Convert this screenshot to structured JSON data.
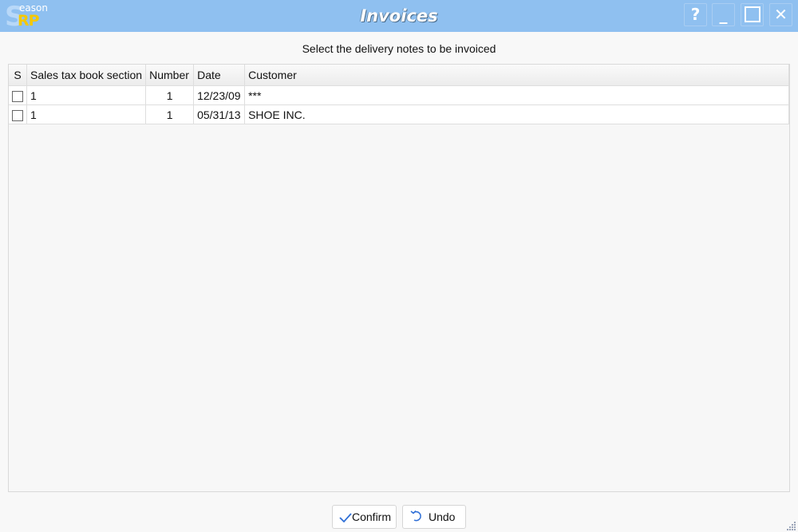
{
  "app": {
    "logo_main": "S",
    "logo_sub": "eason",
    "logo_accent": "RP",
    "window_title": "Invoices"
  },
  "window_controls": {
    "help": "?",
    "minimize": "_",
    "maximize": "☐",
    "close": "✕"
  },
  "prompt": "Select the delivery notes to be invoiced",
  "table": {
    "columns": [
      "S",
      "Sales tax book section",
      "Number",
      "Date",
      "Customer"
    ],
    "rows": [
      {
        "selected": false,
        "section": "1",
        "number": "1",
        "date": "12/23/09",
        "customer": "***"
      },
      {
        "selected": false,
        "section": "1",
        "number": "1",
        "date": "05/31/13",
        "customer": "SHOE INC."
      }
    ]
  },
  "buttons": {
    "confirm": "Confirm",
    "undo": "Undo"
  },
  "colors": {
    "titlebar": "#8fc0f0",
    "accent": "#2f6fd6"
  }
}
